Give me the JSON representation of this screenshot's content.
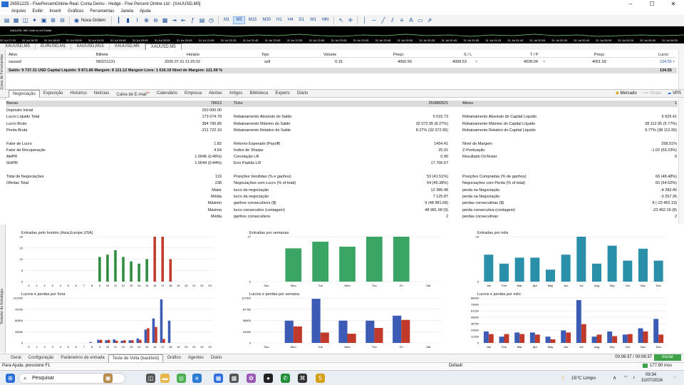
{
  "window": {
    "title": "26551225 - FivePercentOnline-Real: Conta Demo - Hedge - Five Percent Online Ltd - [XAUUSD,M5]"
  },
  "menu": [
    "Arquivo",
    "Exibir",
    "Inserir",
    "Gráficos",
    "Ferramentas",
    "Janela",
    "Ajuda"
  ],
  "toolbar": {
    "new_order": "Nova Ordem",
    "timeframes": [
      "M1",
      "M5",
      "M15",
      "M30",
      "H1",
      "H4",
      "D1",
      "W1",
      "MN"
    ],
    "active_timeframe": "M5"
  },
  "chart_strip": {
    "label": "XAUUSD, M5: Gold vs US Dollar",
    "times": [
      "31 Jul 17:20",
      "31 Jul 18:25",
      "31 Jul 18:45",
      "31 Jul 19:05",
      "31 Jul 19:25",
      "31 Jul 19:45",
      "31 Jul 20:05",
      "31 Jul 20:25",
      "31 Jul 20:45",
      "31 Jul 21:05",
      "31 Jul 21:25",
      "31 Jul 21:45",
      "31 Jul 22:05",
      "31 Jul 22:25",
      "31 Jul 22:45",
      "31 Jul 23:05",
      "31 Jul 23:25",
      "31 Jul 23:45",
      "31 Jul 00:05",
      "31 Jul 00:25",
      "31 Jul 00:45",
      "31 Jul 01:05",
      "31 Jul 01:25",
      "31 Jul 01:49",
      "31 Jul 02:09",
      "31 Jul 02:29",
      "31 Jul 02:49",
      "31 Jul 03:09",
      "31 Jul 03:29",
      "31 Jul 03:49",
      "31 Jul 04:09"
    ]
  },
  "chart_tabs": [
    "XAUUSD,M5",
    "EURUSD,M1",
    "XAUUSD,M15",
    "XAUUSD,M5",
    "XAUUSD,M5"
  ],
  "active_chart_tab": 4,
  "toolbox_label": "Caixa de Ferramentas",
  "trade": {
    "headers": [
      "Ativo",
      "Bilhete",
      "Horário",
      "Tipo",
      "Volume",
      "Preço",
      "S / L",
      "T / P",
      "Preço",
      "Lucro"
    ],
    "row": [
      "xauusd",
      "583211131",
      "2026.07.31 11:25:02",
      "sell",
      "0.15",
      "4060.56",
      "4068.53",
      "4028.04",
      "4051.59",
      "134.55"
    ],
    "balance": "Saldo: 9 737.31 USD  Capital Líquido: 9 871.86  Margem: 8 121.12  Margem Livre: 1 616.19  Nível de Margem: 121.56 %",
    "balance_profit": "134.55"
  },
  "toolbox_tabs": [
    "Negociação",
    "Exposição",
    "Histórico",
    "Notícias",
    "Caixa de E-mail",
    "Calendário",
    "Empresa",
    "Alertas",
    "Artigos",
    "Biblioteca",
    "Experts",
    "Diário"
  ],
  "email_badge": "11",
  "toolbox_right": {
    "market": "Mercado",
    "signals": "Sinais",
    "vps": "VPS"
  },
  "stats": {
    "header": [
      "Barras",
      "78013",
      "Ticks",
      "250880521",
      "Ativos",
      "1"
    ],
    "rows": [
      [
        "Depósito Inicial",
        "250 000.00",
        "",
        "",
        "",
        ""
      ],
      [
        "Lucro Líquido Total",
        "173 074.79",
        "Rebaixamento Absoluto do Saldo",
        "5 015.73",
        "Rebaixamento Absoluto do Capital Líquido",
        "5 929.41"
      ],
      [
        "Lucro Bruto",
        "384 796.89",
        "Rebaixamento Máximo do Saldo",
        "32 072.95 (8.27%)",
        "Rebaixamento Máximo do Capital Líquido",
        "38 112.95 (9.77%)"
      ],
      [
        "Perda Bruta",
        "-211 722.10",
        "Rebaixamento Relativo do Saldo",
        "8.27% (32 072.95)",
        "Rebaixamento Relativo do Capital Líquido",
        "9.77% (38 112.95)"
      ],
      [
        "",
        "",
        "",
        "",
        "",
        ""
      ],
      [
        "Fator de Lucro",
        "1.82",
        "Retorno Esperado (Payoff)",
        "1454.41",
        "Nível de Margem",
        "258.51%"
      ],
      [
        "Fator de Recuperação",
        "4.54",
        "Índice de Sharpe",
        "25.01",
        "Z-Pontuação",
        "-1.02 (69.23%)"
      ],
      [
        "AHPR",
        "1.0046 (0.46%)",
        "Correlação LR",
        "0.90",
        "Resultado OnTester",
        "0"
      ],
      [
        "GHPR",
        "1.0044 (0.44%)",
        "Erro Padrão LR",
        "17 706.57",
        "",
        ""
      ],
      [
        "",
        "",
        "",
        "",
        "",
        ""
      ],
      [
        "Total de Negociações",
        "119",
        "Posições Vendidas (% e ganhos)",
        "53 (41.51%)",
        "Posições Compradas (% de ganhos)",
        "66 (48.48%)"
      ],
      [
        "Ofertas Total",
        "238",
        "Negociações com Lucro (% of total)",
        "54 (45.38%)",
        "Negociações com Perda (% of total)",
        "65 (54.62%)"
      ],
      [
        "",
        "Maior",
        "lucro da negociação",
        "12 385.48",
        "perda na Negociação",
        "-4 283.40"
      ],
      [
        "",
        "Média",
        "lucro da negociação",
        "7 125.87",
        "perda na Negociação",
        "-3 257.26"
      ],
      [
        "",
        "Máximo",
        "ganhos consecutivos ($)",
        "9 (48 981.68)",
        "perdas consecutivas ($)",
        "8 (-23 452.19)"
      ],
      [
        "",
        "Máxima",
        "lucro consecutivo (contagem)",
        "48 981.68 (9)",
        "perda consecutiva (contagem)",
        "-23 452.19 (8)"
      ],
      [
        "",
        "Média",
        "ganhos consecutivos",
        "2",
        "perdas consecutivas",
        "2"
      ]
    ]
  },
  "chart_data": [
    {
      "type": "bar",
      "title": "Entradas pelo horário (Asia,Europe,USA)",
      "categories": [
        "0",
        "1",
        "2",
        "3",
        "4",
        "5",
        "6",
        "7",
        "8",
        "9",
        "10",
        "11",
        "12",
        "13",
        "14",
        "15",
        "16",
        "17",
        "18",
        "19",
        "20",
        "21",
        "22",
        "23"
      ],
      "ylim": [
        0,
        20
      ],
      "yticks": [
        "0",
        "5",
        "10",
        "15",
        "20"
      ],
      "series": [
        {
          "values": [
            0,
            0,
            0,
            0,
            0,
            0,
            0,
            0,
            0,
            11,
            12,
            14,
            11,
            9,
            8,
            10,
            0,
            0,
            0,
            0,
            0,
            0,
            0,
            0
          ],
          "color": "#2e8b3d"
        },
        {
          "values": [
            0,
            0,
            0,
            0,
            0,
            0,
            0,
            0,
            0,
            0,
            0,
            0,
            0,
            0,
            0,
            0,
            20,
            20,
            10,
            0,
            0,
            0,
            0,
            0
          ],
          "color": "#c0392b"
        }
      ]
    },
    {
      "type": "bar",
      "title": "Entradas por semanas",
      "categories": [
        "Sun",
        "Mon",
        "Tue",
        "Wed",
        "Thu",
        "Fri",
        "Sat"
      ],
      "ylim": [
        0,
        27
      ],
      "yticks": [
        "0",
        "27"
      ],
      "series": [
        {
          "values": [
            0,
            20,
            24,
            21,
            27,
            27,
            0
          ],
          "color": "#3aa565"
        }
      ]
    },
    {
      "type": "bar",
      "title": "Entradas por mês",
      "categories": [
        "Jan",
        "Feb",
        "Mar",
        "Apr",
        "May",
        "Jun",
        "Jul",
        "Aug",
        "Sep",
        "Oct",
        "Nov",
        "Dec"
      ],
      "ylim": [
        0,
        15
      ],
      "yticks": [
        "0",
        "15"
      ],
      "series": [
        {
          "values": [
            9,
            6,
            8,
            8,
            4,
            9,
            15,
            6,
            12,
            7,
            11,
            7
          ],
          "color": "#2a8fa8"
        }
      ]
    },
    {
      "type": "bar",
      "title": "Lucros e perdas por hora",
      "categories": [
        "0",
        "1",
        "2",
        "3",
        "4",
        "5",
        "6",
        "7",
        "8",
        "9",
        "10",
        "11",
        "12",
        "13",
        "14",
        "15",
        "16",
        "17",
        "18",
        "19",
        "20",
        "21",
        "22",
        "23"
      ],
      "ylim": [
        0,
        101000
      ],
      "yticks": [
        "0",
        "25250",
        "50500",
        "75750",
        "101000"
      ],
      "series": [
        {
          "name": "",
          "values": [
            0,
            0,
            0,
            0,
            0,
            0,
            0,
            0,
            2000,
            7000,
            6000,
            8000,
            5000,
            6000,
            10000,
            30000,
            55000,
            98000,
            50000,
            0,
            0,
            0,
            0,
            0
          ],
          "color": "#3b5bb5"
        },
        {
          "name": "",
          "values": [
            0,
            0,
            0,
            0,
            0,
            0,
            0,
            0,
            0,
            7000,
            7000,
            5000,
            6000,
            6000,
            7000,
            33000,
            36000,
            9000,
            0,
            0,
            0,
            0,
            0,
            0
          ],
          "color": "#c0392b"
        }
      ]
    },
    {
      "type": "bar",
      "title": "Lucros e perdas por semana",
      "categories": [
        "Sun",
        "Mon",
        "Tue",
        "Wed",
        "Thu",
        "Fri",
        "Sat"
      ],
      "ylim": [
        0,
        117000
      ],
      "yticks": [
        "0",
        "29250",
        "58500",
        "87750",
        "117000"
      ],
      "series": [
        {
          "name": "",
          "values": [
            0,
            58000,
            115000,
            58000,
            58000,
            71000,
            0
          ],
          "color": "#3b5bb5"
        },
        {
          "name": "",
          "values": [
            0,
            43000,
            27000,
            24000,
            39000,
            60000,
            0
          ],
          "color": "#c0392b"
        }
      ]
    },
    {
      "type": "bar",
      "title": "Lucros e perdas por mês",
      "categories": [
        "Jan",
        "Feb",
        "Mar",
        "Apr",
        "May",
        "Jun",
        "Jul",
        "Aug",
        "Sep",
        "Oct",
        "Nov",
        "Dec"
      ],
      "ylim": [
        0,
        86000
      ],
      "yticks": [
        "0",
        "12250",
        "24500",
        "36750",
        "49000",
        "61250",
        "73500",
        "86000"
      ],
      "series": [
        {
          "name": "",
          "values": [
            22000,
            12000,
            20000,
            20000,
            12000,
            24000,
            82000,
            12000,
            22000,
            16000,
            28000,
            46000
          ],
          "color": "#3b5bb5"
        },
        {
          "name": "",
          "values": [
            17000,
            17000,
            17000,
            16000,
            7000,
            20000,
            36000,
            16000,
            13000,
            17000,
            22000,
            16000
          ],
          "color": "#c0392b"
        }
      ]
    }
  ],
  "bottom_tabs": [
    "Geral",
    "Configuração",
    "Parâmetros de entrada",
    "Teste de Volta (backtest)",
    "Gráfico",
    "Agentes",
    "Diário"
  ],
  "active_bottom_tab": 3,
  "tester_label": "Testador de Estratégia",
  "timer": "00:06:37 / 00:06:37",
  "start_button": "Iniciar",
  "status": {
    "help": "Para Ajuda, pressione F1",
    "profile": "Default",
    "memory": "177.90 mss"
  },
  "taskbar": {
    "search": "Pesquisar",
    "weather": "15°C  Limpo",
    "time": "09:34",
    "date": "31/07/2026"
  }
}
